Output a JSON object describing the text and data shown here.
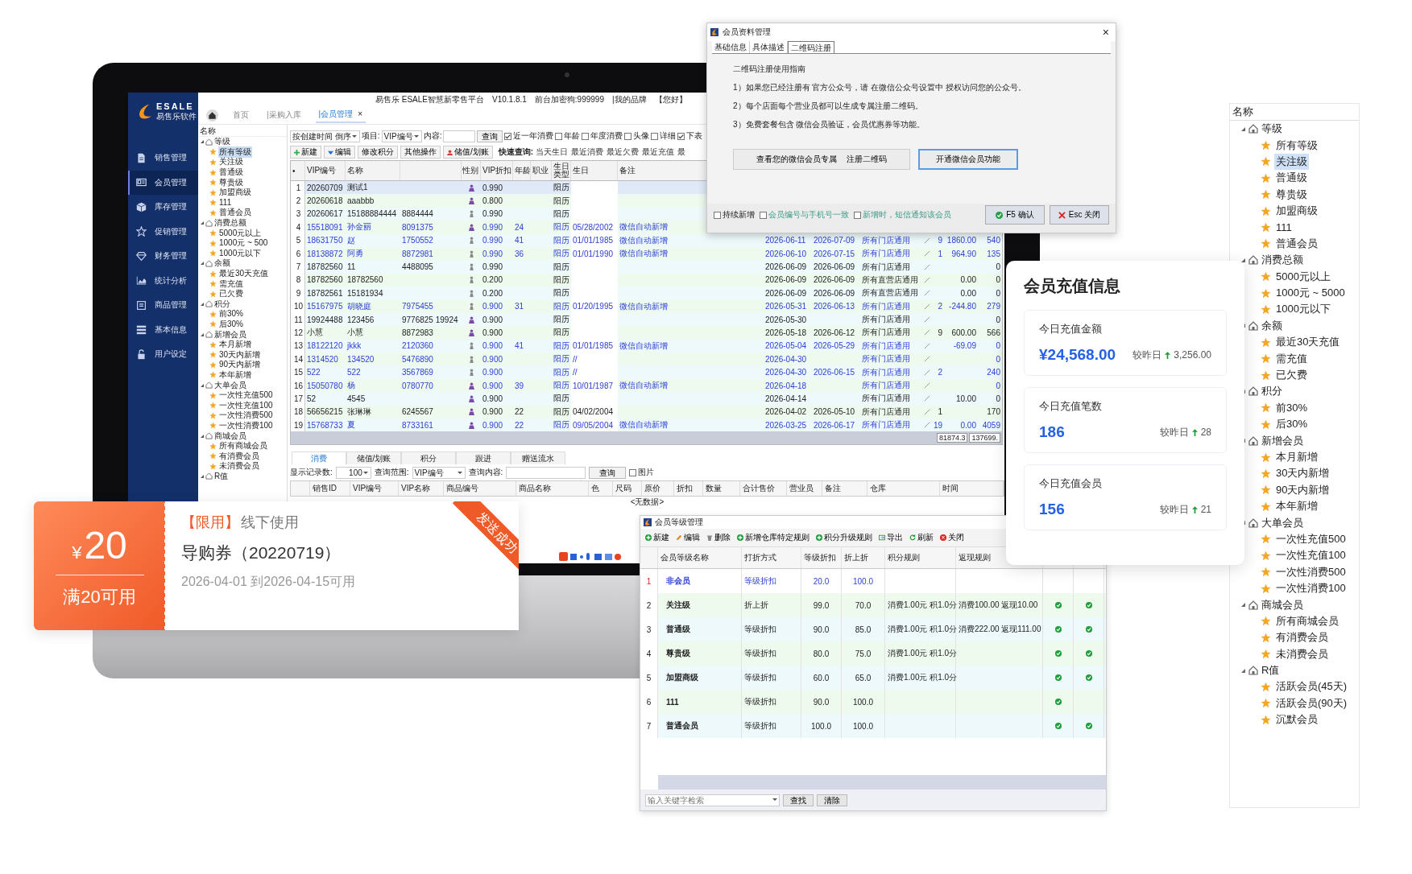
{
  "main_window": {
    "logo": {
      "brand": "ESALE",
      "subtitle": "易售乐软件"
    },
    "sidebar": [
      {
        "label": "销售管理",
        "kind": "document",
        "selected": false
      },
      {
        "label": "会员管理",
        "kind": "card",
        "selected": true
      },
      {
        "label": "库存管理",
        "kind": "box",
        "selected": false
      },
      {
        "label": "促销管理",
        "kind": "star",
        "selected": false
      },
      {
        "label": "财务管理",
        "kind": "diamond",
        "selected": false
      },
      {
        "label": "统计分析",
        "kind": "chart",
        "selected": false
      },
      {
        "label": "商品管理",
        "kind": "calendar",
        "selected": false
      },
      {
        "label": "基本信息",
        "kind": "list",
        "selected": false
      },
      {
        "label": "用户设定",
        "kind": "lock",
        "selected": false
      }
    ],
    "header": [
      "易售乐 ESALE智慧新零售平台",
      "V10.1.8.1",
      "前台加密狗:999999",
      "|我的品牌",
      "【您好】"
    ],
    "tabs": [
      {
        "label": "首页",
        "selected": false
      },
      {
        "label": "|采购入库",
        "selected": false
      },
      {
        "label": "|会员管理",
        "selected": true,
        "close": "×"
      }
    ],
    "tree": {
      "header": "名称",
      "groups": [
        {
          "label": "等级",
          "expanded": true,
          "children": [
            {
              "label": "所有等级",
              "selected": true
            },
            {
              "label": "关注级",
              "selected": false
            },
            {
              "label": "普通级",
              "selected": false
            },
            {
              "label": "尊贵级",
              "selected": false
            },
            {
              "label": "加盟商级",
              "selected": false
            },
            {
              "label": "111",
              "selected": false
            },
            {
              "label": "普通会员",
              "selected": false
            }
          ]
        },
        {
          "label": "消费总额",
          "expanded": true,
          "children": [
            {
              "label": "5000元以上",
              "selected": false
            },
            {
              "label": "1000元 ~ 500",
              "selected": false
            },
            {
              "label": "1000元以下",
              "selected": false
            }
          ]
        },
        {
          "label": "余额",
          "expanded": true,
          "children": [
            {
              "label": "最近30天充值",
              "selected": false
            },
            {
              "label": "需充值",
              "selected": false
            },
            {
              "label": "已欠费",
              "selected": false
            }
          ]
        },
        {
          "label": "积分",
          "expanded": true,
          "children": [
            {
              "label": "前30%",
              "selected": false
            },
            {
              "label": "后30%",
              "selected": false
            }
          ]
        },
        {
          "label": "新增会员",
          "expanded": true,
          "children": [
            {
              "label": "本月新增",
              "selected": false
            },
            {
              "label": "30天内新增",
              "selected": false
            },
            {
              "label": "90天内新增",
              "selected": false
            },
            {
              "label": "本年新增",
              "selected": false
            }
          ]
        },
        {
          "label": "大单会员",
          "expanded": true,
          "children": [
            {
              "label": "一次性充值500",
              "selected": false
            },
            {
              "label": "一次性充值100",
              "selected": false
            },
            {
              "label": "一次性消费500",
              "selected": false
            },
            {
              "label": "一次性消费100",
              "selected": false
            }
          ]
        },
        {
          "label": "商城会员",
          "expanded": true,
          "children": [
            {
              "label": "所有商城会员",
              "selected": false
            },
            {
              "label": "有消费会员",
              "selected": false
            },
            {
              "label": "未消费会员",
              "selected": false
            }
          ]
        },
        {
          "label": "R值",
          "expanded": true
        }
      ]
    },
    "filter": {
      "sort": "按创建时间 倒序",
      "field_label": "项目:",
      "field": "VIP编号",
      "content_label": "内容:",
      "search_button": "查询",
      "checks": [
        {
          "label": "近一年消费",
          "checked": true
        },
        {
          "label": "年龄",
          "checked": false
        },
        {
          "label": "年度消费",
          "checked": false
        },
        {
          "label": "头像",
          "checked": false
        },
        {
          "label": "详细",
          "checked": false
        },
        {
          "label": "下表",
          "checked": true
        }
      ]
    },
    "toolbar": {
      "buttons": [
        {
          "label": "新建",
          "kind": "plus"
        },
        {
          "label": "编辑",
          "kind": "caret"
        },
        {
          "label": "修改积分",
          "kind": "plain"
        },
        {
          "label": "其他操作",
          "kind": "plain"
        },
        {
          "label": "储值/划账",
          "kind": "person"
        }
      ],
      "quick_label": "快速查询:",
      "quick": [
        "当天生日",
        "最近消费",
        "最近欠费",
        "最近充值",
        "最"
      ]
    },
    "table": {
      "index_header": "•",
      "gender_header": "性别",
      "columns": [
        "VIP编号",
        "名称",
        null,
        "VIP折扣",
        "年龄",
        "职业",
        "生日类型",
        "生日",
        "备注"
      ],
      "rows": [
        {
          "no": "1",
          "selected": true,
          "highlighted": false,
          "kind": "female",
          "cells": [
            "20260709",
            "测试1",
            null,
            "0.990",
            null,
            null,
            "阳历",
            null,
            null,
            null,
            null,
            null,
            null,
            null,
            null
          ]
        },
        {
          "no": "2",
          "selected": false,
          "highlighted": false,
          "kind": "female",
          "cells": [
            "20260618",
            "aaabbb",
            null,
            "0.800",
            null,
            null,
            "阳历",
            null,
            null,
            null,
            null,
            null,
            null,
            null,
            null
          ]
        },
        {
          "no": "3",
          "selected": false,
          "highlighted": false,
          "kind": "male",
          "cells": [
            "20260617",
            "15188884444",
            "8884444",
            "0.990",
            null,
            null,
            "阳历",
            null,
            null,
            null,
            null,
            null,
            null,
            null,
            null
          ]
        },
        {
          "no": "4",
          "selected": false,
          "highlighted": true,
          "kind": "female",
          "cells": [
            "15518091",
            "孙金丽",
            "8091375",
            "0.990",
            "24",
            null,
            "阳历",
            "05/28/2002",
            "微信自动新增",
            null,
            null,
            null,
            null,
            null,
            null
          ]
        },
        {
          "no": "5",
          "selected": false,
          "highlighted": true,
          "kind": "male",
          "slash": true,
          "cells": [
            "18631750",
            "赵",
            "1750552",
            "0.990",
            "41",
            null,
            "阳历",
            "01/01/1985",
            "微信自动新增",
            "2026-06-11",
            "2026-07-09",
            "所有门店通用",
            "9",
            "1860.00",
            "540"
          ]
        },
        {
          "no": "6",
          "selected": false,
          "highlighted": true,
          "kind": "male",
          "slash": true,
          "cells": [
            "18138872",
            "阿勇",
            "8872981",
            "0.990",
            "36",
            null,
            "阳历",
            "01/01/1990",
            "微信自动新增",
            "2026-06-10",
            "2026-07-15",
            "所有门店通用",
            "1",
            "964.90",
            "135"
          ]
        },
        {
          "no": "7",
          "selected": false,
          "highlighted": false,
          "kind": "male",
          "slash": true,
          "cells": [
            "18782560",
            "11",
            "4488095",
            "0.990",
            null,
            null,
            "阳历",
            null,
            null,
            "2026-06-09",
            "2026-06-09",
            "所有门店通用",
            null,
            null,
            "0"
          ]
        },
        {
          "no": "8",
          "selected": false,
          "highlighted": false,
          "kind": "male",
          "slash": true,
          "cells": [
            "18782560",
            "18782560",
            null,
            "0.200",
            null,
            null,
            "阳历",
            null,
            null,
            "2026-06-09",
            "2026-06-09",
            "所有直营店通用",
            null,
            "0.00",
            "0"
          ]
        },
        {
          "no": "9",
          "selected": false,
          "highlighted": false,
          "kind": "male",
          "slash": true,
          "cells": [
            "18782561",
            "15181934",
            null,
            "0.200",
            null,
            null,
            "阳历",
            null,
            null,
            "2026-06-09",
            "2026-06-09",
            "所有直营店通用",
            null,
            "0.00",
            "0"
          ]
        },
        {
          "no": "10",
          "selected": false,
          "highlighted": true,
          "kind": "male",
          "slash": true,
          "cells": [
            "15167975",
            "胡晓庭",
            "7975455",
            "0.900",
            "31",
            null,
            "阳历",
            "01/20/1995",
            "微信自动新增",
            "2026-05-31",
            "2026-06-13",
            "所有门店通用",
            "2",
            "-244.80",
            "279"
          ]
        },
        {
          "no": "11",
          "selected": false,
          "highlighted": false,
          "kind": "female",
          "slash": true,
          "cells": [
            "19924488",
            "123456",
            "9776825 19924",
            "0.900",
            null,
            null,
            "阳历",
            null,
            null,
            "2026-05-30",
            null,
            "所有门店通用",
            null,
            null,
            "0"
          ]
        },
        {
          "no": "12",
          "selected": false,
          "highlighted": false,
          "kind": "female",
          "slash": true,
          "cells": [
            "小慧",
            "小慧",
            "8872983",
            "0.900",
            null,
            null,
            "阳历",
            null,
            null,
            "2026-05-18",
            "2026-06-12",
            "所有门店通用",
            "9",
            "600.00",
            "566"
          ]
        },
        {
          "no": "13",
          "selected": false,
          "highlighted": true,
          "kind": "male",
          "slash": true,
          "cells": [
            "18122120",
            "jkkk",
            "2120360",
            "0.900",
            "41",
            null,
            "阳历",
            "01/01/1985",
            "微信自动新增",
            "2026-05-04",
            "2026-05-29",
            "所有门店通用",
            null,
            "-69.09",
            "0"
          ]
        },
        {
          "no": "14",
          "selected": false,
          "highlighted": true,
          "kind": "male",
          "slash": true,
          "cells": [
            "1314520",
            "134520",
            "5476890",
            "0.900",
            null,
            null,
            "阳历",
            "//",
            null,
            "2026-04-30",
            null,
            "所有门店通用",
            null,
            null,
            "0"
          ]
        },
        {
          "no": "15",
          "selected": false,
          "highlighted": true,
          "kind": "male",
          "slash": true,
          "cells": [
            "522",
            "522",
            "3567869",
            "0.900",
            null,
            null,
            "阳历",
            "//",
            null,
            "2026-04-30",
            "2026-06-15",
            "所有门店通用",
            "2",
            null,
            "240"
          ]
        },
        {
          "no": "16",
          "selected": false,
          "highlighted": true,
          "kind": "female",
          "slash": true,
          "cells": [
            "15050780",
            "杨",
            "0780770",
            "0.900",
            "39",
            null,
            "阳历",
            "10/01/1987",
            "微信自动新增",
            "2026-04-18",
            null,
            "所有门店通用",
            null,
            null,
            "0"
          ]
        },
        {
          "no": "17",
          "selected": false,
          "highlighted": false,
          "kind": "female",
          "slash": true,
          "cells": [
            "52",
            "4545",
            null,
            "0.900",
            null,
            null,
            "阳历",
            null,
            null,
            "2026-04-14",
            null,
            "所有门店通用",
            null,
            "10.00",
            "0"
          ]
        },
        {
          "no": "18",
          "selected": false,
          "highlighted": false,
          "kind": "female",
          "slash": true,
          "cells": [
            "56656215",
            "张琳琳",
            "6245567",
            "0.900",
            "22",
            null,
            "阳历",
            "04/02/2004",
            null,
            "2026-04-02",
            "2026-05-10",
            "所有门店通用",
            "1",
            null,
            "170"
          ]
        },
        {
          "no": "19",
          "selected": false,
          "highlighted": true,
          "kind": "female",
          "slash": true,
          "cells": [
            "15768733",
            "夏",
            "8733161",
            "0.900",
            "22",
            null,
            "阳历",
            "09/05/2004",
            "微信自动新增",
            "2026-03-25",
            "2026-06-17",
            "所有门店通用",
            "19",
            "0.00",
            "4059"
          ]
        }
      ],
      "totals": [
        "81874.3",
        "137699."
      ]
    },
    "detail": {
      "tabs": [
        {
          "label": "消费",
          "selected": true
        },
        {
          "label": "储值/划账",
          "selected": false
        },
        {
          "label": "积分",
          "selected": false
        },
        {
          "label": "跟进",
          "selected": false
        },
        {
          "label": "赠送流水",
          "selected": false
        }
      ],
      "count_label": "显示记录数:",
      "count": "100",
      "range_label": "查询范围:",
      "range": "VIP编号",
      "content_label": "查询内容:",
      "search_button": "查询",
      "picture_check": {
        "label": "图片",
        "checked": false
      },
      "columns": [
        "销售ID",
        "VIP编号",
        "VIP名称",
        "商品编号",
        "商品名称",
        "色",
        "尺码",
        "原价",
        "折扣",
        "数量",
        "合计售价",
        "营业员",
        "备注",
        "仓库",
        "时间"
      ],
      "empty": "<无数据>"
    }
  },
  "dialog": {
    "title": "会员资料管理",
    "close": "×",
    "tabs": [
      {
        "label": "基础信息",
        "selected": false
      },
      {
        "label": "具体描述",
        "selected": false
      },
      {
        "label": "二维码注册",
        "selected": true
      }
    ],
    "heading": "二维码注册使用指南",
    "lines": [
      "1）如果您已经注册有 官方公众号，请 在微信公众号设置中 授权访问您的公众号。",
      "2）每个店面每个营业员都可以生成专属注册二维码。",
      "3）免费套餐包含 微信会员验证，会员优惠券等功能。"
    ],
    "buttons": [
      {
        "label": "查看您的微信会员专属    注册二维码",
        "focused": false
      },
      {
        "label": "开通微信会员功能",
        "focused": true
      }
    ],
    "checks": [
      {
        "label": "持续新增",
        "checked": false,
        "kind": "plain"
      },
      {
        "label": "会员编号与手机号一致",
        "checked": false,
        "kind": "accent"
      },
      {
        "label": "新增时，短信通知该会员",
        "checked": false,
        "kind": "accent"
      }
    ],
    "confirm": "F5 确认",
    "cancel": "Esc 关闭"
  },
  "coupon": {
    "currency": "¥",
    "amount": "20",
    "condition": "满20可用",
    "tag": "【限用】",
    "usage": "线下使用",
    "name": "导购券（20220719）",
    "validity": "2026-04-01 到2026-04-15可用",
    "ribbon": "发送成功"
  },
  "recharge": {
    "title": "会员充值信息",
    "stats": [
      {
        "label": "今日充值金额",
        "value": "¥24,568.00",
        "compare": "较昨日",
        "delta": "3,256.00"
      },
      {
        "label": "今日充值笔数",
        "value": "186",
        "compare": "较昨日",
        "delta": "28"
      },
      {
        "label": "今日充值会员",
        "value": "156",
        "compare": "较昨日",
        "delta": "21"
      }
    ]
  },
  "level_window": {
    "title": "会员等级管理",
    "toolbar": [
      {
        "label": "新建",
        "kind": "add"
      },
      {
        "label": "编辑",
        "kind": "pencil"
      },
      {
        "label": "删除",
        "kind": "trash"
      },
      {
        "label": "新增仓库特定规则",
        "kind": "add"
      },
      {
        "label": "积分升级规则",
        "kind": "add"
      },
      {
        "label": "导出",
        "kind": "export"
      },
      {
        "label": "刷新",
        "kind": "refresh"
      },
      {
        "label": "关闭",
        "kind": "stop"
      }
    ],
    "columns": [
      "会员等级名称",
      "打折方式",
      "等级折扣",
      "折上折",
      "积分规则",
      "返现规则"
    ],
    "rows": [
      {
        "no": "1",
        "selected": true,
        "cells": [
          "非会员",
          "等级折扣",
          "20.0",
          "100.0",
          null,
          null
        ],
        "checks": [
          false,
          false
        ]
      },
      {
        "no": "2",
        "selected": false,
        "cells": [
          "关注级",
          "折上折",
          "99.0",
          "70.0",
          "消费1.00元 积1.0分",
          "消费100.00 返现10.00"
        ],
        "checks": [
          true,
          true
        ]
      },
      {
        "no": "3",
        "selected": false,
        "cells": [
          "普通级",
          "等级折扣",
          "90.0",
          "85.0",
          "消费1.00元 积1.0分",
          "消费222.00 返现111.00"
        ],
        "checks": [
          true,
          true
        ]
      },
      {
        "no": "4",
        "selected": false,
        "cells": [
          "尊贵级",
          "等级折扣",
          "80.0",
          "75.0",
          "消费1.00元 积1.0分",
          null
        ],
        "checks": [
          true,
          true
        ]
      },
      {
        "no": "5",
        "selected": false,
        "cells": [
          "加盟商级",
          "等级折扣",
          "60.0",
          "65.0",
          "消费1.00元 积1.0分",
          null
        ],
        "checks": [
          true,
          true
        ]
      },
      {
        "no": "6",
        "selected": false,
        "cells": [
          "111",
          "等级折扣",
          "90.0",
          "100.0",
          null,
          null
        ],
        "checks": [
          true,
          false
        ]
      },
      {
        "no": "7",
        "selected": false,
        "cells": [
          "普通会员",
          "等级折扣",
          "100.0",
          "100.0",
          null,
          null
        ],
        "checks": [
          true,
          true
        ]
      }
    ],
    "search": {
      "placeholder": "输入关键字检索"
    },
    "buttons": [
      "查找",
      "清除"
    ]
  },
  "side_tree": {
    "header": "名称",
    "groups": [
      {
        "label": "等级",
        "expanded": true,
        "children": [
          {
            "label": "所有等级",
            "selected": false
          },
          {
            "label": "关注级",
            "selected": true
          },
          {
            "label": "普通级",
            "selected": false
          },
          {
            "label": "尊贵级",
            "selected": false
          },
          {
            "label": "加盟商级",
            "selected": false
          },
          {
            "label": "111",
            "selected": false
          },
          {
            "label": "普通会员",
            "selected": false
          }
        ]
      },
      {
        "label": "消费总额",
        "expanded": true,
        "children": [
          {
            "label": "5000元以上",
            "selected": false
          },
          {
            "label": "1000元 ~ 5000",
            "selected": false
          },
          {
            "label": "1000元以下",
            "selected": false
          }
        ]
      },
      {
        "label": "余额",
        "expanded": true,
        "children": [
          {
            "label": "最近30天充值",
            "selected": false
          },
          {
            "label": "需充值",
            "selected": false
          },
          {
            "label": "已欠费",
            "selected": false
          }
        ]
      },
      {
        "label": "积分",
        "expanded": true,
        "children": [
          {
            "label": "前30%",
            "selected": false
          },
          {
            "label": "后30%",
            "selected": false
          }
        ]
      },
      {
        "label": "新增会员",
        "expanded": true,
        "children": [
          {
            "label": "本月新增",
            "selected": false
          },
          {
            "label": "30天内新增",
            "selected": false
          },
          {
            "label": "90天内新增",
            "selected": false
          },
          {
            "label": "本年新增",
            "selected": false
          }
        ]
      },
      {
        "label": "大单会员",
        "expanded": true,
        "children": [
          {
            "label": "一次性充值500",
            "selected": false
          },
          {
            "label": "一次性充值100",
            "selected": false
          },
          {
            "label": "一次性消费500",
            "selected": false
          },
          {
            "label": "一次性消费100",
            "selected": false
          }
        ]
      },
      {
        "label": "商城会员",
        "expanded": true,
        "children": [
          {
            "label": "所有商城会员",
            "selected": false
          },
          {
            "label": "有消费会员",
            "selected": false
          },
          {
            "label": "未消费会员",
            "selected": false
          }
        ]
      },
      {
        "label": "R值",
        "expanded": true,
        "children": [
          {
            "label": "活跃会员(45天)",
            "selected": false
          },
          {
            "label": "活跃会员(90天)",
            "selected": false
          },
          {
            "label": "沉默会员",
            "selected": false
          }
        ]
      }
    ]
  }
}
